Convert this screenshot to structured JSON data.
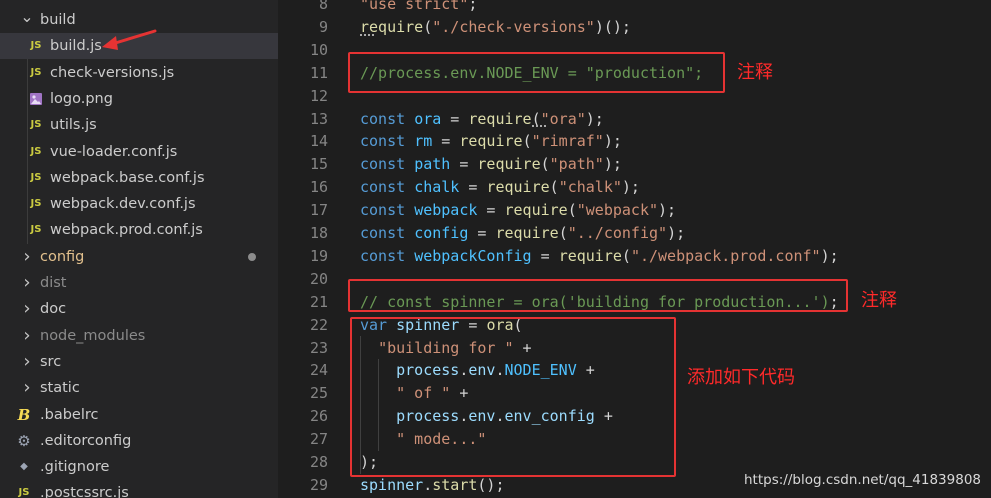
{
  "explorer": {
    "items": [
      {
        "label": "build",
        "kind": "folder-open",
        "icon": "chevron-down-icon"
      },
      {
        "label": "build.js",
        "kind": "file",
        "icon": "js-file-icon",
        "icon_text": "JS",
        "selected": true
      },
      {
        "label": "check-versions.js",
        "kind": "file",
        "icon": "js-file-icon",
        "icon_text": "JS"
      },
      {
        "label": "logo.png",
        "kind": "file",
        "icon": "image-file-icon"
      },
      {
        "label": "utils.js",
        "kind": "file",
        "icon": "js-file-icon",
        "icon_text": "JS"
      },
      {
        "label": "vue-loader.conf.js",
        "kind": "file",
        "icon": "js-file-icon",
        "icon_text": "JS"
      },
      {
        "label": "webpack.base.conf.js",
        "kind": "file",
        "icon": "js-file-icon",
        "icon_text": "JS"
      },
      {
        "label": "webpack.dev.conf.js",
        "kind": "file",
        "icon": "js-file-icon",
        "icon_text": "JS"
      },
      {
        "label": "webpack.prod.conf.js",
        "kind": "file",
        "icon": "js-file-icon",
        "icon_text": "JS"
      },
      {
        "label": "config",
        "kind": "folder",
        "icon": "chevron-right-icon",
        "modified": true
      },
      {
        "label": "dist",
        "kind": "folder",
        "icon": "chevron-right-icon",
        "muted": true
      },
      {
        "label": "doc",
        "kind": "folder",
        "icon": "chevron-right-icon"
      },
      {
        "label": "node_modules",
        "kind": "folder",
        "icon": "chevron-right-icon",
        "muted": true
      },
      {
        "label": "src",
        "kind": "folder",
        "icon": "chevron-right-icon"
      },
      {
        "label": "static",
        "kind": "folder",
        "icon": "chevron-right-icon"
      },
      {
        "label": ".babelrc",
        "kind": "file",
        "icon": "babel-file-icon",
        "icon_text": "B"
      },
      {
        "label": ".editorconfig",
        "kind": "file",
        "icon": "gear-file-icon",
        "icon_text": "⚙"
      },
      {
        "label": ".gitignore",
        "kind": "file",
        "icon": "dot-file-icon",
        "icon_text": "◆"
      },
      {
        "label": ".postcssrc.js",
        "kind": "file",
        "icon": "js-file-icon",
        "icon_text": "JS"
      }
    ]
  },
  "editor": {
    "lines": [
      {
        "n": "8",
        "tokens": [
          [
            "str",
            "\"use strict\""
          ],
          [
            "pl",
            ";"
          ]
        ]
      },
      {
        "n": "9",
        "tokens": [
          [
            "fn",
            "require"
          ],
          [
            "pl",
            "("
          ],
          [
            "str",
            "\"./check-versions\""
          ],
          [
            "pl",
            ")();"
          ]
        ]
      },
      {
        "n": "10",
        "tokens": []
      },
      {
        "n": "11",
        "tokens": [
          [
            "cm",
            "//process.env.NODE_ENV = \"production\";"
          ]
        ]
      },
      {
        "n": "12",
        "tokens": []
      },
      {
        "n": "13",
        "tokens": [
          [
            "kw",
            "const "
          ],
          [
            "const",
            "ora"
          ],
          [
            "pl",
            " = "
          ],
          [
            "fn",
            "require"
          ],
          [
            "pl",
            "("
          ],
          [
            "str",
            "\"ora\""
          ],
          [
            "pl",
            ");"
          ]
        ]
      },
      {
        "n": "14",
        "tokens": [
          [
            "kw",
            "const "
          ],
          [
            "const",
            "rm"
          ],
          [
            "pl",
            " = "
          ],
          [
            "fn",
            "require"
          ],
          [
            "pl",
            "("
          ],
          [
            "str",
            "\"rimraf\""
          ],
          [
            "pl",
            ");"
          ]
        ]
      },
      {
        "n": "15",
        "tokens": [
          [
            "kw",
            "const "
          ],
          [
            "const",
            "path"
          ],
          [
            "pl",
            " = "
          ],
          [
            "fn",
            "require"
          ],
          [
            "pl",
            "("
          ],
          [
            "str",
            "\"path\""
          ],
          [
            "pl",
            ");"
          ]
        ]
      },
      {
        "n": "16",
        "tokens": [
          [
            "kw",
            "const "
          ],
          [
            "const",
            "chalk"
          ],
          [
            "pl",
            " = "
          ],
          [
            "fn",
            "require"
          ],
          [
            "pl",
            "("
          ],
          [
            "str",
            "\"chalk\""
          ],
          [
            "pl",
            ");"
          ]
        ]
      },
      {
        "n": "17",
        "tokens": [
          [
            "kw",
            "const "
          ],
          [
            "const",
            "webpack"
          ],
          [
            "pl",
            " = "
          ],
          [
            "fn",
            "require"
          ],
          [
            "pl",
            "("
          ],
          [
            "str",
            "\"webpack\""
          ],
          [
            "pl",
            ");"
          ]
        ]
      },
      {
        "n": "18",
        "tokens": [
          [
            "kw",
            "const "
          ],
          [
            "const",
            "config"
          ],
          [
            "pl",
            " = "
          ],
          [
            "fn",
            "require"
          ],
          [
            "pl",
            "("
          ],
          [
            "str",
            "\"../config\""
          ],
          [
            "pl",
            ");"
          ]
        ]
      },
      {
        "n": "19",
        "tokens": [
          [
            "kw",
            "const "
          ],
          [
            "const",
            "webpackConfig"
          ],
          [
            "pl",
            " = "
          ],
          [
            "fn",
            "require"
          ],
          [
            "pl",
            "("
          ],
          [
            "str",
            "\"./webpack.prod.conf\""
          ],
          [
            "pl",
            ");"
          ]
        ]
      },
      {
        "n": "20",
        "tokens": []
      },
      {
        "n": "21",
        "tokens": [
          [
            "cm",
            "// const spinner = ora('building for production...')"
          ],
          [
            "pl",
            ";"
          ]
        ]
      },
      {
        "n": "22",
        "tokens": [
          [
            "kw",
            "var "
          ],
          [
            "id",
            "spinner"
          ],
          [
            "pl",
            " = "
          ],
          [
            "fn",
            "ora"
          ],
          [
            "pl",
            "("
          ]
        ]
      },
      {
        "n": "23",
        "tokens": [
          [
            "pl",
            "  "
          ],
          [
            "str",
            "\"building for \""
          ],
          [
            "pl",
            " +"
          ]
        ]
      },
      {
        "n": "24",
        "tokens": [
          [
            "pl",
            "    "
          ],
          [
            "id",
            "process"
          ],
          [
            "pl",
            "."
          ],
          [
            "id",
            "env"
          ],
          [
            "pl",
            "."
          ],
          [
            "const",
            "NODE_ENV"
          ],
          [
            "pl",
            " +"
          ]
        ]
      },
      {
        "n": "25",
        "tokens": [
          [
            "pl",
            "    "
          ],
          [
            "str",
            "\" of \""
          ],
          [
            "pl",
            " +"
          ]
        ]
      },
      {
        "n": "26",
        "tokens": [
          [
            "pl",
            "    "
          ],
          [
            "id",
            "process"
          ],
          [
            "pl",
            "."
          ],
          [
            "id",
            "env"
          ],
          [
            "pl",
            "."
          ],
          [
            "id",
            "env_config"
          ],
          [
            "pl",
            " +"
          ]
        ]
      },
      {
        "n": "27",
        "tokens": [
          [
            "pl",
            "    "
          ],
          [
            "str",
            "\" mode...\""
          ]
        ]
      },
      {
        "n": "28",
        "tokens": [
          [
            "pl",
            ");"
          ]
        ]
      },
      {
        "n": "29",
        "tokens": [
          [
            "id",
            "spinner"
          ],
          [
            "pl",
            "."
          ],
          [
            "fn",
            "start"
          ],
          [
            "pl",
            "();"
          ]
        ]
      }
    ]
  },
  "annotations": {
    "note1": "注释",
    "note2": "注释",
    "note3": "添加如下代码"
  },
  "watermark": "https://blog.csdn.net/qq_41839808",
  "colors": {
    "highlight_box": "#e53333",
    "annotation_text": "#ff2a2a"
  }
}
